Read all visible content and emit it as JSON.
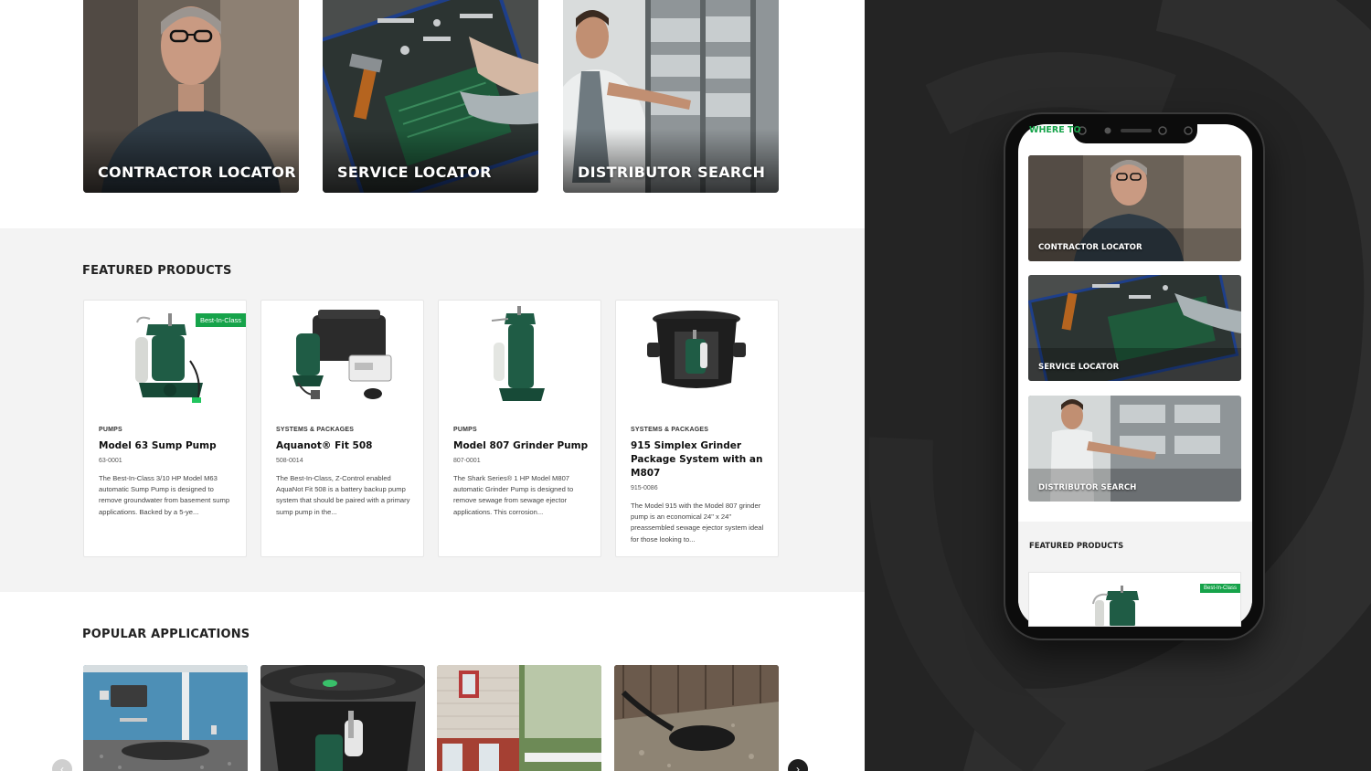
{
  "desktop": {
    "hero_cards": [
      {
        "label": "CONTRACTOR LOCATOR"
      },
      {
        "label": "SERVICE LOCATOR"
      },
      {
        "label": "DISTRIBUTOR SEARCH"
      }
    ],
    "featured": {
      "title": "FEATURED PRODUCTS",
      "products": [
        {
          "badge": "Best-In-Class",
          "category": "PUMPS",
          "name": "Model 63 Sump Pump",
          "sku": "63-0001",
          "description": "The Best-In-Class 3/10 HP Model M63 automatic Sump Pump is designed to remove groundwater from basement sump applications. Backed by a 5-ye..."
        },
        {
          "category": "SYSTEMS & PACKAGES",
          "name": "Aquanot® Fit 508",
          "sku": "508-0014",
          "description": "The Best-In-Class, Z-Control enabled AquaNot Fit 508 is a battery backup pump system that should be paired with a primary sump pump in the..."
        },
        {
          "category": "PUMPS",
          "name": "Model 807 Grinder Pump",
          "sku": "807-0001",
          "description": "The Shark Series® 1 HP Model M807 automatic Grinder Pump is designed to remove sewage from sewage ejector applications.  This corrosion..."
        },
        {
          "category": "SYSTEMS & PACKAGES",
          "name": "915 Simplex Grinder Package System with an M807",
          "sku": "915-0086",
          "description": "The Model 915 with the Model 807 grinder pump is an economical 24\" x 24\" preassembled sewage ejector system ideal for those looking to..."
        }
      ]
    },
    "popular": {
      "title": "POPULAR APPLICATIONS",
      "prev_icon": "‹",
      "next_icon": "›"
    }
  },
  "mobile": {
    "header_partial": "WHERE TO",
    "cards": [
      {
        "label": "CONTRACTOR LOCATOR"
      },
      {
        "label": "SERVICE LOCATOR"
      },
      {
        "label": "DISTRIBUTOR SEARCH"
      }
    ],
    "featured_title": "FEATURED PRODUCTS",
    "badge": "Best-In-Class"
  },
  "colors": {
    "accent_green": "#16a34a",
    "pump_green": "#1f5c45",
    "dark_panel": "#242424",
    "featured_bg": "#f3f3f3"
  }
}
